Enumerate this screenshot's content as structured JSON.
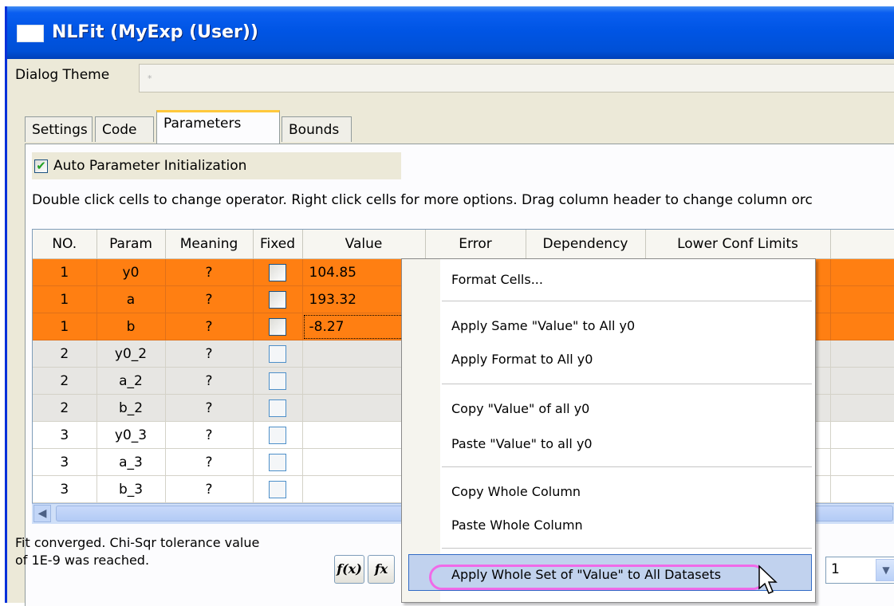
{
  "window": {
    "title": "NLFit (MyExp (User))"
  },
  "theme": {
    "label": "Dialog Theme",
    "value": "*"
  },
  "tabs": [
    {
      "label": "Settings"
    },
    {
      "label": "Code"
    },
    {
      "label": "Parameters"
    },
    {
      "label": "Bounds"
    }
  ],
  "parameters": {
    "auto_init_label": "Auto Parameter Initialization",
    "hint": "Double click cells to change operator. Right click cells for more options. Drag column header to change column orc",
    "columns": [
      "NO.",
      "Param",
      "Meaning",
      "Fixed",
      "Value",
      "Error",
      "Dependency",
      "Lower Conf Limits"
    ],
    "rows": [
      {
        "no": "1",
        "param": "y0",
        "meaning": "?",
        "value": "104.85"
      },
      {
        "no": "1",
        "param": "a",
        "meaning": "?",
        "value": "193.32"
      },
      {
        "no": "1",
        "param": "b",
        "meaning": "?",
        "value": "-8.27"
      },
      {
        "no": "2",
        "param": "y0_2",
        "meaning": "?",
        "value": "--"
      },
      {
        "no": "2",
        "param": "a_2",
        "meaning": "?",
        "value": "--"
      },
      {
        "no": "2",
        "param": "b_2",
        "meaning": "?",
        "value": "--"
      },
      {
        "no": "3",
        "param": "y0_3",
        "meaning": "?",
        "value": "--"
      },
      {
        "no": "3",
        "param": "a_3",
        "meaning": "?",
        "value": "--"
      },
      {
        "no": "3",
        "param": "b_3",
        "meaning": "?",
        "value": "--"
      }
    ]
  },
  "status": {
    "line1": "Fit converged. Chi-Sqr tolerance value",
    "line2": "of 1E-9 was reached."
  },
  "toolbar": {
    "btn1_icon": "f(x)-icon",
    "btn2_icon": "fx-icon",
    "iterations_value": "1"
  },
  "context_menu": {
    "items": [
      "Format Cells...",
      "Apply Same \"Value\" to All y0",
      "Apply Format to All y0",
      "Copy \"Value\" of all y0",
      "Paste \"Value\" to all y0",
      "Copy Whole Column",
      "Paste Whole Column",
      "Apply Whole Set of \"Value\" to All Datasets"
    ],
    "highlight_color": "#f06ae8"
  },
  "colors": {
    "selected_row": "#ff7f12",
    "title_bar": "#0055e5",
    "dialog_bg": "#ece9d8"
  }
}
